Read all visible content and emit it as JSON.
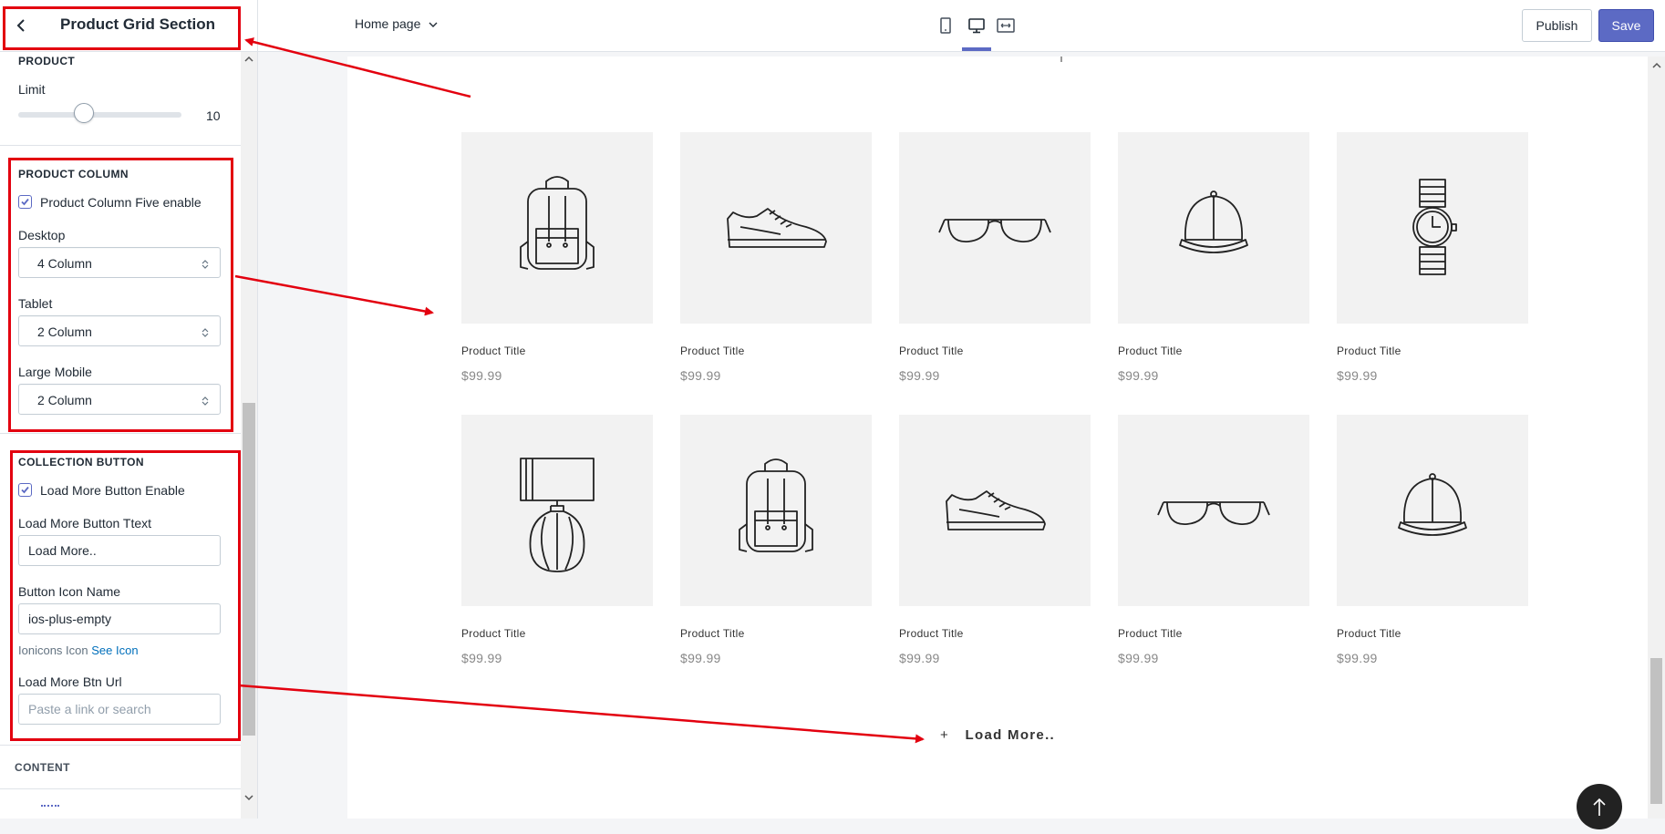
{
  "sidebar": {
    "title": "Product Grid Section",
    "product": {
      "heading": "PRODUCT",
      "limit_label": "Limit",
      "limit_value": "10",
      "limit_fraction": 0.4
    },
    "product_column": {
      "heading": "PRODUCT COLUMN",
      "five_enable_label": "Product Column Five enable",
      "five_enable_checked": true,
      "desktop_label": "Desktop",
      "desktop_value": "4 Column",
      "tablet_label": "Tablet",
      "tablet_value": "2 Column",
      "large_mobile_label": "Large Mobile",
      "large_mobile_value": "2 Column"
    },
    "collection_button": {
      "heading": "COLLECTION BUTTON",
      "enable_label": "Load More Button Enable",
      "enable_checked": true,
      "text_label": "Load More Button Ttext",
      "text_value": "Load More..",
      "icon_label": "Button Icon Name",
      "icon_value": "ios-plus-empty",
      "help_text": "Ionicons Icon",
      "help_link": "See Icon",
      "url_label": "Load More Btn Url",
      "url_placeholder": "Paste a link or search"
    },
    "content_heading": "CONTENT"
  },
  "topbar": {
    "page_select": "Home page",
    "publish_label": "Publish",
    "save_label": "Save",
    "view_icons": [
      "mobile-view-icon",
      "desktop-view-icon",
      "fullwidth-view-icon"
    ],
    "active_view": "desktop"
  },
  "preview": {
    "products": [
      {
        "title": "Product Title",
        "price": "$99.99",
        "icon": "backpack-icon"
      },
      {
        "title": "Product Title",
        "price": "$99.99",
        "icon": "sneaker-icon"
      },
      {
        "title": "Product Title",
        "price": "$99.99",
        "icon": "sunglasses-icon"
      },
      {
        "title": "Product Title",
        "price": "$99.99",
        "icon": "cap-icon"
      },
      {
        "title": "Product Title",
        "price": "$99.99",
        "icon": "watch-icon"
      },
      {
        "title": "Product Title",
        "price": "$99.99",
        "icon": "lamp-icon"
      },
      {
        "title": "Product Title",
        "price": "$99.99",
        "icon": "backpack-icon"
      },
      {
        "title": "Product Title",
        "price": "$99.99",
        "icon": "sneaker-icon"
      },
      {
        "title": "Product Title",
        "price": "$99.99",
        "icon": "sunglasses-icon"
      },
      {
        "title": "Product Title",
        "price": "$99.99",
        "icon": "cap-icon"
      }
    ],
    "load_more_icon": "+",
    "load_more_label": "Load More.."
  },
  "colors": {
    "accent": "#5c6ac4",
    "annotation_red": "#e3000f",
    "link": "#006fbb",
    "image_bg": "#f2f2f2"
  }
}
